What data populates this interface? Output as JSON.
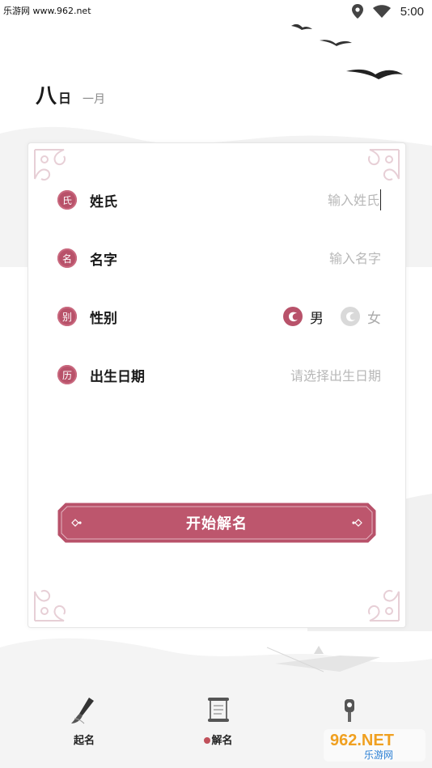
{
  "status_bar": {
    "watermark": "乐游网 www.962.net",
    "time": "5:00",
    "icons": [
      "location-icon",
      "wifi-icon"
    ]
  },
  "date": {
    "day": "八",
    "day_suffix": "日",
    "month": "一月"
  },
  "form": {
    "surname": {
      "seal": "氏",
      "label": "姓氏",
      "placeholder": "输入姓氏"
    },
    "given_name": {
      "seal": "名",
      "label": "名字",
      "placeholder": "输入名字"
    },
    "gender": {
      "seal": "别",
      "label": "性别",
      "options": [
        {
          "label": "男",
          "selected": true
        },
        {
          "label": "女",
          "selected": false
        }
      ]
    },
    "birth_date": {
      "seal": "历",
      "label": "出生日期",
      "placeholder": "请选择出生日期"
    },
    "submit_label": "开始解名"
  },
  "bottom_nav": [
    {
      "label": "起名",
      "icon": "brush-icon"
    },
    {
      "label": "解名",
      "icon": "scroll-icon",
      "active": true
    },
    {
      "label": "",
      "icon": "lamp-icon"
    }
  ],
  "watermark_logo": {
    "big": "962.NET",
    "small": "乐游网"
  },
  "colors": {
    "accent": "#b8526a",
    "accent_dark": "#a84560",
    "ornament": "#e7cfd6"
  }
}
